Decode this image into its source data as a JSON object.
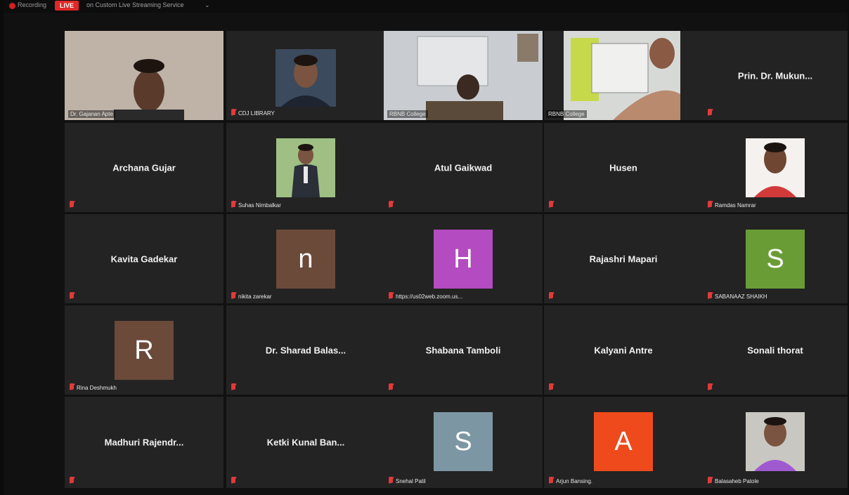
{
  "topbar": {
    "recording_label": "Recording",
    "live_label": "LIVE",
    "stream_label": "on Custom Live Streaming Service"
  },
  "tiles": {
    "r1c1": {
      "label": "Dr. Gajanan Apte"
    },
    "r1c2": {
      "label": "CDJ LIBRARY"
    },
    "r1c3": {
      "label": "RBNB College"
    },
    "r1c4": {
      "label": "RBNB College"
    },
    "r1c5": {
      "name": "Prin. Dr. Mukun..."
    },
    "r2c1": {
      "name": "Archana Gujar"
    },
    "r2c2": {
      "label": "Suhas Nimbalkar"
    },
    "r2c3": {
      "name": "Atul Gaikwad"
    },
    "r2c4": {
      "name": "Husen"
    },
    "r2c5": {
      "label": "Ramdas Namrar"
    },
    "r3c1": {
      "name": "Kavita Gadekar"
    },
    "r3c2": {
      "initial": "n",
      "label": "nikita zarekar",
      "color": "#6b4a3a"
    },
    "r3c3": {
      "initial": "H",
      "label": "https://us02web.zoom.us...",
      "color": "#b44bc0"
    },
    "r3c4": {
      "name": "Rajashri Mapari"
    },
    "r3c5": {
      "initial": "S",
      "label": "SABANAAZ SHAIKH",
      "color": "#6a9c36"
    },
    "r4c1": {
      "initial": "R",
      "label": "Rina Deshmukh",
      "color": "#6b4a3a"
    },
    "r4c2": {
      "name": "Dr. Sharad Balas..."
    },
    "r4c3": {
      "name": "Shabana Tamboli"
    },
    "r4c4": {
      "name": "Kalyani Antre"
    },
    "r4c5": {
      "name": "Sonali thorat"
    },
    "r5c1": {
      "name": "Madhuri Rajendr..."
    },
    "r5c2": {
      "name": "Ketki Kunal Ban..."
    },
    "r5c3": {
      "initial": "S",
      "label": "Snehal Patil",
      "color": "#7c97a3"
    },
    "r5c4": {
      "initial": "A",
      "label": "Arjun Bansing.",
      "color": "#ef4a1c"
    },
    "r5c5": {
      "label": "Balasaheb Patole"
    }
  },
  "colors": {
    "active_border": "#d4e05a",
    "tile_bg": "#232323",
    "mic_muted": "#e23a3a"
  }
}
